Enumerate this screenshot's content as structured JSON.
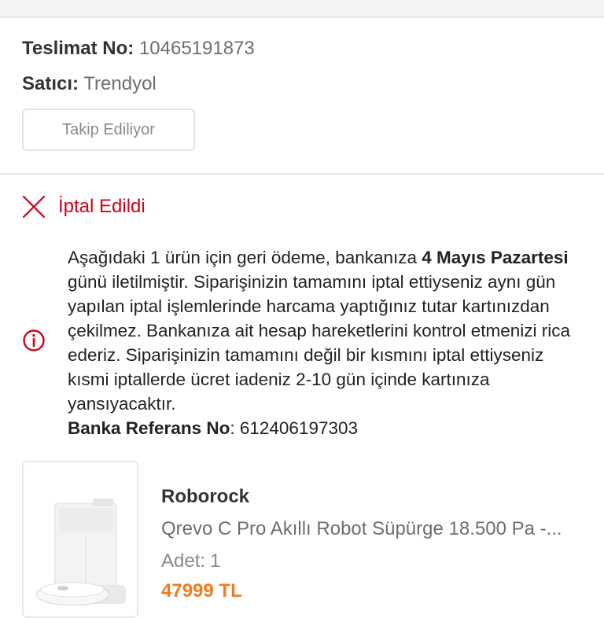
{
  "delivery": {
    "no_label": "Teslimat No:",
    "no_value": "10465191873",
    "seller_label": "Satıcı:",
    "seller_value": "Trendyol",
    "track_button": "Takip Ediliyor"
  },
  "status": {
    "icon": "close-icon",
    "text": "İptal Edildi",
    "color": "#d0021b"
  },
  "notice": {
    "icon": "info-icon",
    "part1": "Aşağıdaki 1 ürün için geri ödeme, bankanıza ",
    "date_bold": "4 Mayıs Pazartesi",
    "part2": " günü iletilmiştir. Siparişinizin tamamını iptal ettiyseniz aynı gün yapılan iptal işlemlerinde harcama yaptığınız tutar kartınızdan çekilmez. Bankanıza ait hesap hareketlerini kontrol etmenizi rica ederiz. Siparişinizin tamamını değil bir kısmını iptal ettiyseniz kısmi iptallerde ücret iadeniz 2-10 gün içinde kartınıza yansıyacaktır.",
    "ref_label": "Banka Referans No",
    "ref_sep": ": ",
    "ref_value": "612406197303"
  },
  "product": {
    "brand": "Roborock",
    "name": "Qrevo C Pro Akıllı Robot Süpürge 18.500 Pa -...",
    "qty_label": "Adet:",
    "qty_value": "1",
    "price": "47999 TL",
    "price_color": "#f27a1a"
  }
}
